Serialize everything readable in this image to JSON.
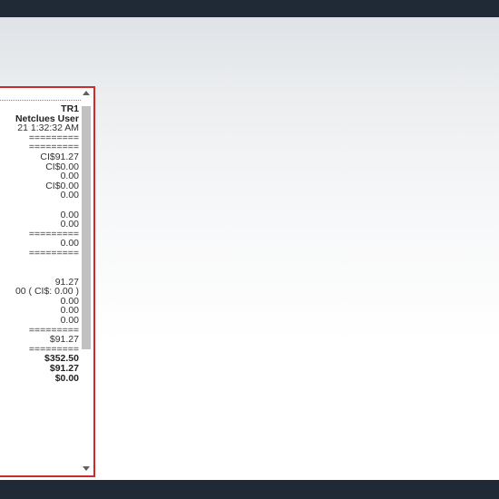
{
  "receipt": {
    "lines": [
      {
        "text": "",
        "bold": false,
        "dotted": true
      },
      {
        "text": "TR1",
        "bold": true
      },
      {
        "text": "Netclues User",
        "bold": true
      },
      {
        "text": "21 1:32:32 AM",
        "bold": false
      },
      {
        "text": "=========",
        "bold": false
      },
      {
        "text": "=========",
        "bold": false
      },
      {
        "text": "CI$91.27",
        "bold": false
      },
      {
        "text": "CI$0.00",
        "bold": false
      },
      {
        "text": "0.00",
        "bold": false
      },
      {
        "text": "CI$0.00",
        "bold": false
      },
      {
        "text": "0.00",
        "bold": false
      },
      {
        "text": "",
        "bold": false
      },
      {
        "text": "0.00",
        "bold": false
      },
      {
        "text": "0.00",
        "bold": false
      },
      {
        "text": "=========",
        "bold": false
      },
      {
        "text": "0.00",
        "bold": false
      },
      {
        "text": "=========",
        "bold": false
      },
      {
        "text": "",
        "bold": false
      },
      {
        "text": "",
        "bold": false
      },
      {
        "text": "91.27",
        "bold": false
      },
      {
        "text": "00 ( CI$: 0.00 )",
        "bold": false
      },
      {
        "text": "0.00",
        "bold": false
      },
      {
        "text": "0.00",
        "bold": false
      },
      {
        "text": "0.00",
        "bold": false
      },
      {
        "text": "=========",
        "bold": false
      },
      {
        "text": "$91.27",
        "bold": false
      },
      {
        "text": "=========",
        "bold": false
      },
      {
        "text": "$352.50",
        "bold": true
      },
      {
        "text": "$91.27",
        "bold": true
      },
      {
        "text": "$0.00",
        "bold": true
      }
    ]
  },
  "colors": {
    "frame": "#1f2a36",
    "panel_border": "#cc2b2b",
    "scroll_thumb": "#c1c1c1"
  },
  "scrollbar": {
    "up_icon": "chevron-up-icon",
    "down_icon": "chevron-down-icon"
  }
}
